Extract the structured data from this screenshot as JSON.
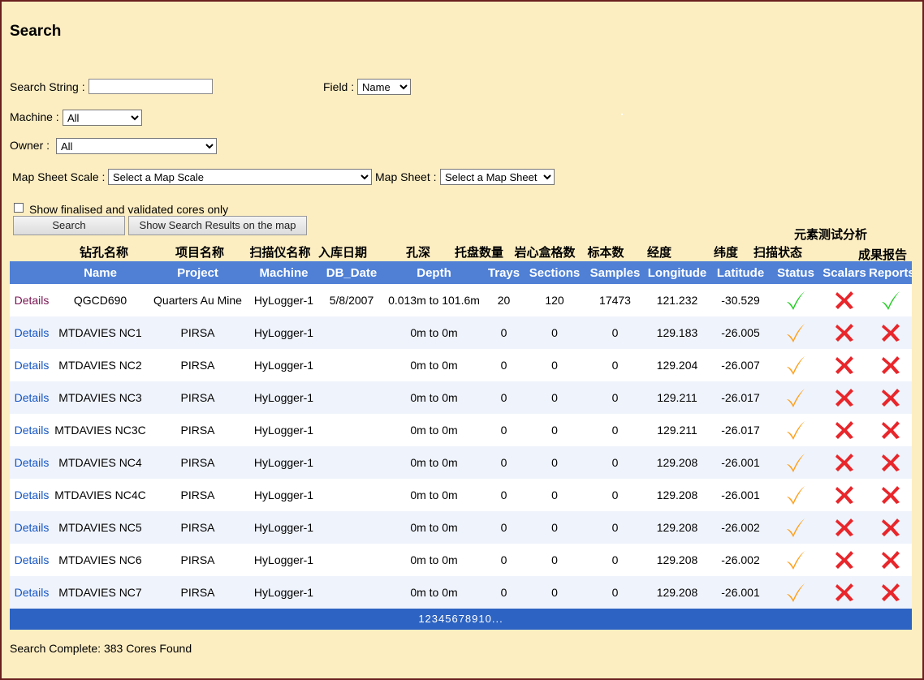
{
  "page": {
    "title": "Search"
  },
  "form": {
    "search_string_label": "Search String :",
    "search_string_value": "",
    "field_label": "Field :",
    "field_value": "Name",
    "machine_label": "Machine :",
    "machine_value": "All",
    "owner_label": "Owner :",
    "owner_value": "All",
    "map_scale_label": "Map Sheet Scale :",
    "map_scale_value": "Select a Map Scale",
    "map_sheet_label": "Map Sheet :",
    "map_sheet_value": "Select a Map Sheet",
    "finalised_label": "Show finalised and validated cores only",
    "finalised_checked": false,
    "search_button": "Search",
    "map_button": "Show Search Results on the map"
  },
  "chinese_headers": {
    "name": "钻孔名称",
    "project": "项目名称",
    "machine": "扫描仪名称",
    "db_date": "入库日期",
    "depth": "孔深",
    "trays": "托盘数量",
    "sections": "岩心盒格数",
    "samples": "标本数",
    "longitude": "经度",
    "latitude": "纬度",
    "status": "扫描状态",
    "scalars": "元素测试分析",
    "reports": "成果报告"
  },
  "table": {
    "headers": {
      "name": "Name",
      "project": "Project",
      "machine": "Machine",
      "db_date": "DB_Date",
      "depth": "Depth",
      "trays": "Trays",
      "sections": "Sections",
      "samples": "Samples",
      "longitude": "Longitude",
      "latitude": "Latitude",
      "status": "Status",
      "scalars": "Scalars",
      "reports": "Reports"
    },
    "rows": [
      {
        "details": "Details",
        "name": "QGCD690",
        "project": "Quarters Au Mine",
        "machine": "HyLogger-1",
        "db_date": "5/8/2007",
        "depth": "0.013m to 101.6m",
        "trays": "20",
        "sections": "120",
        "samples": "17473",
        "longitude": "121.232",
        "latitude": "-30.529",
        "status": "check-green",
        "scalars": "cross-red",
        "reports": "check-green"
      },
      {
        "details": "Details",
        "name": "MTDAVIES NC1",
        "project": "PIRSA",
        "machine": "HyLogger-1",
        "db_date": "",
        "depth": "0m to 0m",
        "trays": "0",
        "sections": "0",
        "samples": "0",
        "longitude": "129.183",
        "latitude": "-26.005",
        "status": "check-orange",
        "scalars": "cross-red",
        "reports": "cross-red"
      },
      {
        "details": "Details",
        "name": "MTDAVIES NC2",
        "project": "PIRSA",
        "machine": "HyLogger-1",
        "db_date": "",
        "depth": "0m to 0m",
        "trays": "0",
        "sections": "0",
        "samples": "0",
        "longitude": "129.204",
        "latitude": "-26.007",
        "status": "check-orange",
        "scalars": "cross-red",
        "reports": "cross-red"
      },
      {
        "details": "Details",
        "name": "MTDAVIES NC3",
        "project": "PIRSA",
        "machine": "HyLogger-1",
        "db_date": "",
        "depth": "0m to 0m",
        "trays": "0",
        "sections": "0",
        "samples": "0",
        "longitude": "129.211",
        "latitude": "-26.017",
        "status": "check-orange",
        "scalars": "cross-red",
        "reports": "cross-red"
      },
      {
        "details": "Details",
        "name": "MTDAVIES NC3C",
        "project": "PIRSA",
        "machine": "HyLogger-1",
        "db_date": "",
        "depth": "0m to 0m",
        "trays": "0",
        "sections": "0",
        "samples": "0",
        "longitude": "129.211",
        "latitude": "-26.017",
        "status": "check-orange",
        "scalars": "cross-red",
        "reports": "cross-red"
      },
      {
        "details": "Details",
        "name": "MTDAVIES NC4",
        "project": "PIRSA",
        "machine": "HyLogger-1",
        "db_date": "",
        "depth": "0m to 0m",
        "trays": "0",
        "sections": "0",
        "samples": "0",
        "longitude": "129.208",
        "latitude": "-26.001",
        "status": "check-orange",
        "scalars": "cross-red",
        "reports": "cross-red"
      },
      {
        "details": "Details",
        "name": "MTDAVIES NC4C",
        "project": "PIRSA",
        "machine": "HyLogger-1",
        "db_date": "",
        "depth": "0m to 0m",
        "trays": "0",
        "sections": "0",
        "samples": "0",
        "longitude": "129.208",
        "latitude": "-26.001",
        "status": "check-orange",
        "scalars": "cross-red",
        "reports": "cross-red"
      },
      {
        "details": "Details",
        "name": "MTDAVIES NC5",
        "project": "PIRSA",
        "machine": "HyLogger-1",
        "db_date": "",
        "depth": "0m to 0m",
        "trays": "0",
        "sections": "0",
        "samples": "0",
        "longitude": "129.208",
        "latitude": "-26.002",
        "status": "check-orange",
        "scalars": "cross-red",
        "reports": "cross-red"
      },
      {
        "details": "Details",
        "name": "MTDAVIES NC6",
        "project": "PIRSA",
        "machine": "HyLogger-1",
        "db_date": "",
        "depth": "0m to 0m",
        "trays": "0",
        "sections": "0",
        "samples": "0",
        "longitude": "129.208",
        "latitude": "-26.002",
        "status": "check-orange",
        "scalars": "cross-red",
        "reports": "cross-red"
      },
      {
        "details": "Details",
        "name": "MTDAVIES NC7",
        "project": "PIRSA",
        "machine": "HyLogger-1",
        "db_date": "",
        "depth": "0m to 0m",
        "trays": "0",
        "sections": "0",
        "samples": "0",
        "longitude": "129.208",
        "latitude": "-26.001",
        "status": "check-orange",
        "scalars": "cross-red",
        "reports": "cross-red"
      }
    ]
  },
  "pager": {
    "text": "12345678910..."
  },
  "status_text": "Search Complete: 383 Cores Found",
  "colors": {
    "check_green": "#22cc22",
    "check_orange": "#ff9f1a",
    "cross_red": "#e8262b",
    "header_bg": "#4f80d6",
    "pager_bg": "#2d63c2",
    "page_bg": "#fdeec2"
  }
}
